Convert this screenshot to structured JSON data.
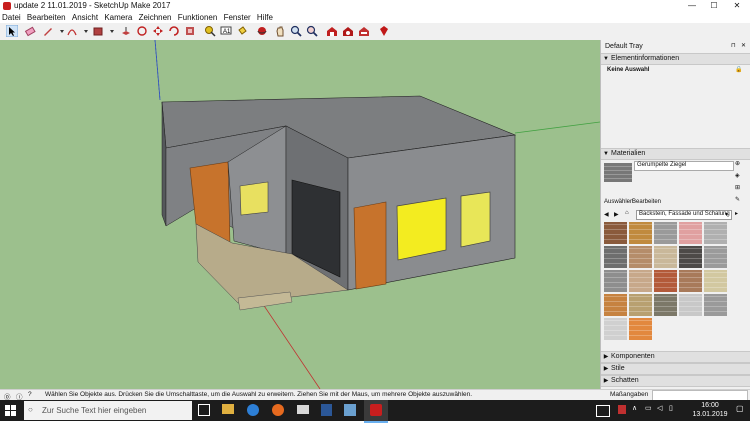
{
  "window": {
    "title": "update 2 11.01.2019 - SketchUp Make 2017",
    "controls": {
      "minimize": "—",
      "maximize": "☐",
      "close": "✕"
    }
  },
  "menu": [
    "Datei",
    "Bearbeiten",
    "Ansicht",
    "Kamera",
    "Zeichnen",
    "Funktionen",
    "Fenster",
    "Hilfe"
  ],
  "toolbar": {
    "icons": [
      "select-icon",
      "eraser-icon",
      "pencil-icon",
      "arc-icon",
      "rectangle-icon",
      "push-pull-icon",
      "rotate-icon",
      "move-icon",
      "follow-me-icon",
      "offset-icon",
      "tape-measure-icon",
      "text-icon",
      "paint-bucket-icon",
      "orbit-icon",
      "pan-icon",
      "zoom-icon",
      "zoom-extents-icon",
      "warehouse-icon",
      "extension-warehouse-icon",
      "layout-icon",
      "ruby-icon"
    ]
  },
  "tray": {
    "title": "Default Tray",
    "entity_info": {
      "header": "Elementinformationen",
      "selection": "Keine Auswahl"
    },
    "materials": {
      "header": "Materialien",
      "current_material": "Gerumpelte Ziegel",
      "tabs": [
        "Auswählen",
        "Bearbeiten"
      ],
      "collection": "Backstein, Fassade und Schalung",
      "swatch_colors": [
        "#8a5a3c",
        "#c08a3e",
        "#9a9a9a",
        "#e0a0a0",
        "#b0b0b0",
        "#6e6e6e",
        "#b58d6a",
        "#c9b89a",
        "#4d4a48",
        "#9b9b9b",
        "#8e8e8e",
        "#c7a88a",
        "#b35a3a",
        "#a87a5a",
        "#d2c8a0",
        "#c68240",
        "#b8a070",
        "#7c7868",
        "#c8c8c8",
        "#9a9a9a",
        "#d0d0d0",
        "#e2883e"
      ]
    },
    "collapsed_panels": [
      "Komponenten",
      "Stile",
      "Schatten"
    ]
  },
  "statusbar": {
    "message": "Wählen Sie Objekte aus. Drücken Sie die Umschalttaste, um die Auswahl zu erweitern. Ziehen Sie mit der Maus, um mehrere Objekte auszuwählen.",
    "measurements_label": "Maßangaben",
    "measurements_value": ""
  },
  "taskbar": {
    "search_placeholder": "Zur Suche Text hier eingeben",
    "apps": [
      "task-view-icon",
      "file-explorer-icon",
      "edge-icon",
      "firefox-icon",
      "mail-icon",
      "word-icon",
      "photos-icon",
      "sketchup-icon"
    ],
    "time": "16:00",
    "date": "13.01.2019"
  }
}
